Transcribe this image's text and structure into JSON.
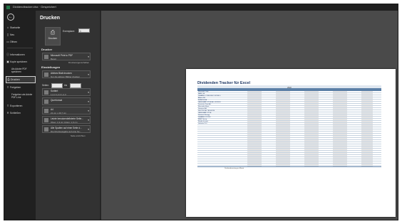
{
  "window": {
    "title": "Dividendtracker.xlsx  ·  Gespeichert"
  },
  "backstage": {
    "items": [
      {
        "label": "Startseite",
        "icon": "home-icon"
      },
      {
        "label": "Neu",
        "icon": "new-doc-icon"
      },
      {
        "label": "Öffnen",
        "icon": "folder-icon"
      },
      {
        "label": "Informationen",
        "icon": "info-icon"
      },
      {
        "label": "Kopie speichern",
        "icon": "save-copy-icon"
      },
      {
        "label": "Als Adobe PDF speichern",
        "icon": "pdf-icon"
      },
      {
        "label": "Drucken",
        "icon": "printer-icon",
        "selected": true
      },
      {
        "label": "Freigeben",
        "icon": "share-icon"
      },
      {
        "label": "Freigeben als Adobe PDF-Link",
        "icon": "pdf-link-icon"
      },
      {
        "label": "Exportieren",
        "icon": "export-icon"
      },
      {
        "label": "Schließen",
        "icon": "close-icon"
      }
    ]
  },
  "print_panel": {
    "heading": "Drucken",
    "print_button": "Drucken",
    "copies_label": "Exemplare:",
    "copies_value": "1",
    "printer_section": "Drucker",
    "printer_name": "Microsoft Print to PDF",
    "printer_status": "Bereit",
    "printer_properties": "Druckereigenschaften",
    "settings_section": "Einstellungen",
    "options": [
      {
        "line1": "Aktives Blatt drucken",
        "line2": "Nur die aktiven Blätter drucken"
      },
      {
        "line1": "Sortiert",
        "line2": "1,2,3   1,2,3   1,2,3"
      },
      {
        "line1": "Querformat",
        "line2": ""
      },
      {
        "line1": "A4",
        "line2": "21 cm x 29,7 cm"
      },
      {
        "line1": "Letzte benutzerdefinierte Seite...",
        "line2": "Oben: 1,9 cm Unten: 1,9 cm"
      },
      {
        "line1": "Alle Spalten auf einer Seite d...",
        "line2": "Die Druckausgabe auf eine Se..."
      }
    ],
    "pages_label": "Seiten:",
    "pages_to": "bis",
    "page_setup": "Seite einrichten"
  },
  "preview": {
    "title": "Dividenden Tracker für Excel",
    "year": "2022",
    "total_label": "Dividendenertrag pro Monat",
    "rows": [
      "Microsoft Corp.",
      "BASF SE",
      "ISHARES CORE MSCI WORLD",
      "Allianz SE",
      "MUNICH RE",
      "VANGUARD FTSE ALL-WORLD",
      "Deutsche Post AG",
      "Mercedes-Benz",
      "Siemens AG",
      "DEUTSCHE TELEKOM",
      "VANGUARD FTSE",
      "Siemens Energy",
      "ISHARES STOXX",
      "BMW Group",
      "Realty Income",
      "Unilever PLC"
    ]
  },
  "colors": {
    "accent": "#217346",
    "header_blue": "#5b7fa6",
    "title_blue": "#1f3864"
  }
}
